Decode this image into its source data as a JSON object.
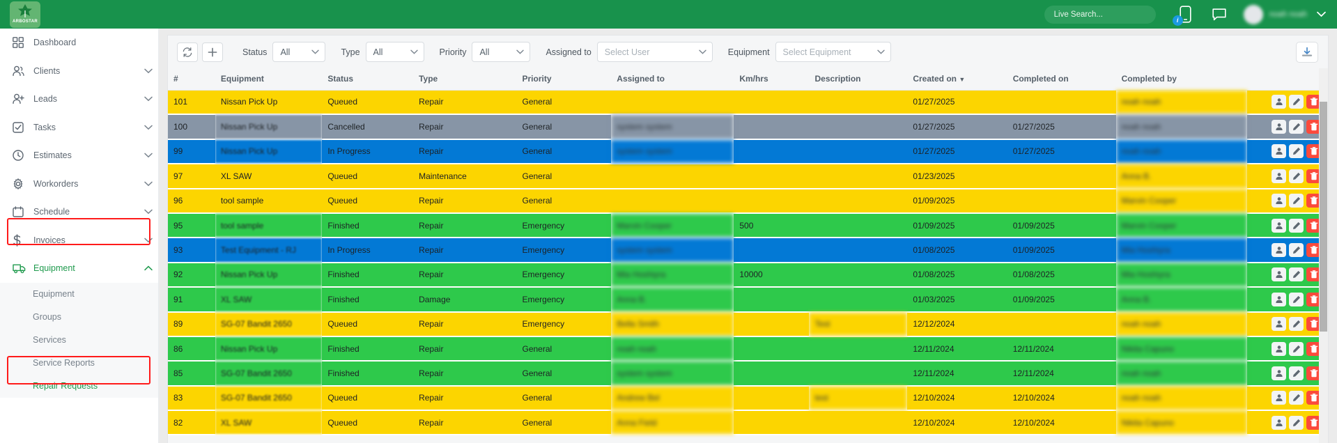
{
  "header": {
    "brand_name": "ARBOSTAR",
    "search_placeholder": "Live Search...",
    "phone_badge": "i",
    "user_name": "noah noah"
  },
  "sidebar": {
    "items": [
      {
        "label": "Dashboard",
        "icon": "grid-icon",
        "has_chevron": false,
        "active": false
      },
      {
        "label": "Clients",
        "icon": "users-icon",
        "has_chevron": true,
        "active": false
      },
      {
        "label": "Leads",
        "icon": "user-plus-icon",
        "has_chevron": true,
        "active": false
      },
      {
        "label": "Tasks",
        "icon": "check-box-icon",
        "has_chevron": true,
        "active": false
      },
      {
        "label": "Estimates",
        "icon": "clock-icon",
        "has_chevron": true,
        "active": false
      },
      {
        "label": "Workorders",
        "icon": "gear-icon",
        "has_chevron": true,
        "active": false
      },
      {
        "label": "Schedule",
        "icon": "calendar-icon",
        "has_chevron": true,
        "active": false
      },
      {
        "label": "Invoices",
        "icon": "dollar-icon",
        "has_chevron": true,
        "active": false
      },
      {
        "label": "Equipment",
        "icon": "truck-icon",
        "has_chevron": true,
        "active": true
      }
    ],
    "sub_items": [
      {
        "label": "Equipment",
        "active": false
      },
      {
        "label": "Groups",
        "active": false
      },
      {
        "label": "Services",
        "active": false
      },
      {
        "label": "Service Reports",
        "active": false
      },
      {
        "label": "Repair Requests",
        "active": true
      }
    ]
  },
  "toolbar": {
    "refresh_icon": "refresh-icon",
    "add_icon": "plus-icon",
    "export_icon": "download-icon",
    "filters": [
      {
        "label": "Status",
        "value": "All",
        "placeholder": false
      },
      {
        "label": "Type",
        "value": "All",
        "placeholder": false
      },
      {
        "label": "Priority",
        "value": "All",
        "placeholder": false
      },
      {
        "label": "Assigned to",
        "value": "Select User",
        "placeholder": true
      },
      {
        "label": "Equipment",
        "value": "Select Equipment",
        "placeholder": true
      }
    ]
  },
  "table": {
    "columns": [
      "#",
      "Equipment",
      "Status",
      "Type",
      "Priority",
      "Assigned to",
      "Km/hrs",
      "Description",
      "Created on",
      "Completed on",
      "Completed by"
    ],
    "sort_column": "Created on",
    "sort_direction": "desc",
    "sort_indicator": "▼",
    "row_actions": [
      {
        "name": "assign-user-button",
        "icon": "user-icon"
      },
      {
        "name": "edit-button",
        "icon": "pencil-icon"
      },
      {
        "name": "delete-button",
        "icon": "trash-icon"
      }
    ],
    "status_colors": {
      "Queued": "#fcd500",
      "Cancelled": "#8795a6",
      "In Progress": "#0379d5",
      "Finished": "#2ec94b"
    },
    "rows": [
      {
        "num": "101",
        "equipment": "Nissan Pick Up",
        "status": "Queued",
        "type": "Repair",
        "priority": "General",
        "assigned_to": "",
        "km_hrs": "",
        "description": "",
        "created_on": "01/27/2025",
        "completed_on": "",
        "completed_by": "noah noah",
        "row_class": "r-queued",
        "blur_equipment": false
      },
      {
        "num": "100",
        "equipment": "Nissan Pick Up",
        "status": "Cancelled",
        "type": "Repair",
        "priority": "General",
        "assigned_to": "system system",
        "km_hrs": "",
        "description": "",
        "created_on": "01/27/2025",
        "completed_on": "01/27/2025",
        "completed_by": "noah noah",
        "row_class": "r-cancel",
        "blur_equipment": true
      },
      {
        "num": "99",
        "equipment": "Nissan Pick Up",
        "status": "In Progress",
        "type": "Repair",
        "priority": "General",
        "assigned_to": "system system",
        "km_hrs": "",
        "description": "",
        "created_on": "01/27/2025",
        "completed_on": "01/27/2025",
        "completed_by": "noah noah",
        "row_class": "r-progress",
        "blur_equipment": true
      },
      {
        "num": "97",
        "equipment": "XL SAW",
        "status": "Queued",
        "type": "Maintenance",
        "priority": "General",
        "assigned_to": "",
        "km_hrs": "",
        "description": "",
        "created_on": "01/23/2025",
        "completed_on": "",
        "completed_by": "Anna B.",
        "row_class": "r-queued",
        "blur_equipment": false
      },
      {
        "num": "96",
        "equipment": "tool sample",
        "status": "Queued",
        "type": "Repair",
        "priority": "General",
        "assigned_to": "",
        "km_hrs": "",
        "description": "",
        "created_on": "01/09/2025",
        "completed_on": "",
        "completed_by": "Marvin Cooper",
        "row_class": "r-queued",
        "blur_equipment": false
      },
      {
        "num": "95",
        "equipment": "tool sample",
        "status": "Finished",
        "type": "Repair",
        "priority": "Emergency",
        "assigned_to": "Marvin Cooper",
        "km_hrs": "500",
        "description": "",
        "created_on": "01/09/2025",
        "completed_on": "01/09/2025",
        "completed_by": "Marvin Cooper",
        "row_class": "r-finished",
        "blur_equipment": true
      },
      {
        "num": "93",
        "equipment": "Test Equipment - RJ",
        "status": "In Progress",
        "type": "Repair",
        "priority": "Emergency",
        "assigned_to": "system system",
        "km_hrs": "",
        "description": "",
        "created_on": "01/08/2025",
        "completed_on": "01/09/2025",
        "completed_by": "Mia Hoshiyra",
        "row_class": "r-progress",
        "blur_equipment": true
      },
      {
        "num": "92",
        "equipment": "Nissan Pick Up",
        "status": "Finished",
        "type": "Repair",
        "priority": "Emergency",
        "assigned_to": "Mia Hoshiyra",
        "km_hrs": "10000",
        "description": "",
        "created_on": "01/08/2025",
        "completed_on": "01/08/2025",
        "completed_by": "Mia Hoshiyra",
        "row_class": "r-finished",
        "blur_equipment": true
      },
      {
        "num": "91",
        "equipment": "XL SAW",
        "status": "Finished",
        "type": "Damage",
        "priority": "Emergency",
        "assigned_to": "Anna B.",
        "km_hrs": "",
        "description": "",
        "created_on": "01/03/2025",
        "completed_on": "01/09/2025",
        "completed_by": "Anna B.",
        "row_class": "r-finished",
        "blur_equipment": true
      },
      {
        "num": "89",
        "equipment": "SG-07 Bandit 2650",
        "status": "Queued",
        "type": "Repair",
        "priority": "Emergency",
        "assigned_to": "Bella Smith",
        "km_hrs": "",
        "description": "Test",
        "created_on": "12/12/2024",
        "completed_on": "",
        "completed_by": "noah noah",
        "row_class": "r-queued",
        "blur_equipment": true
      },
      {
        "num": "86",
        "equipment": "Nissan Pick Up",
        "status": "Finished",
        "type": "Repair",
        "priority": "General",
        "assigned_to": "noah noah",
        "km_hrs": "",
        "description": "",
        "created_on": "12/11/2024",
        "completed_on": "12/11/2024",
        "completed_by": "Nikita Capuno",
        "row_class": "r-finished",
        "blur_equipment": true
      },
      {
        "num": "85",
        "equipment": "SG-07 Bandit 2650",
        "status": "Finished",
        "type": "Repair",
        "priority": "General",
        "assigned_to": "system system",
        "km_hrs": "",
        "description": "",
        "created_on": "12/11/2024",
        "completed_on": "12/11/2024",
        "completed_by": "noah noah",
        "row_class": "r-finished",
        "blur_equipment": true
      },
      {
        "num": "83",
        "equipment": "SG-07 Bandit 2650",
        "status": "Queued",
        "type": "Repair",
        "priority": "General",
        "assigned_to": "Andrew Bel",
        "km_hrs": "",
        "description": "test",
        "created_on": "12/10/2024",
        "completed_on": "12/10/2024",
        "completed_by": "noah noah",
        "row_class": "r-queued",
        "blur_equipment": true
      },
      {
        "num": "82",
        "equipment": "XL SAW",
        "status": "Queued",
        "type": "Repair",
        "priority": "General",
        "assigned_to": "Anna Field",
        "km_hrs": "",
        "description": "",
        "created_on": "12/10/2024",
        "completed_on": "12/10/2024",
        "completed_by": "Nikita Capuno",
        "row_class": "r-queued",
        "blur_equipment": true
      }
    ]
  },
  "annotations": {
    "equipment_highlight": "Equipment",
    "repair_requests_highlight": "Repair Requests",
    "color": "#ff1a1a"
  }
}
